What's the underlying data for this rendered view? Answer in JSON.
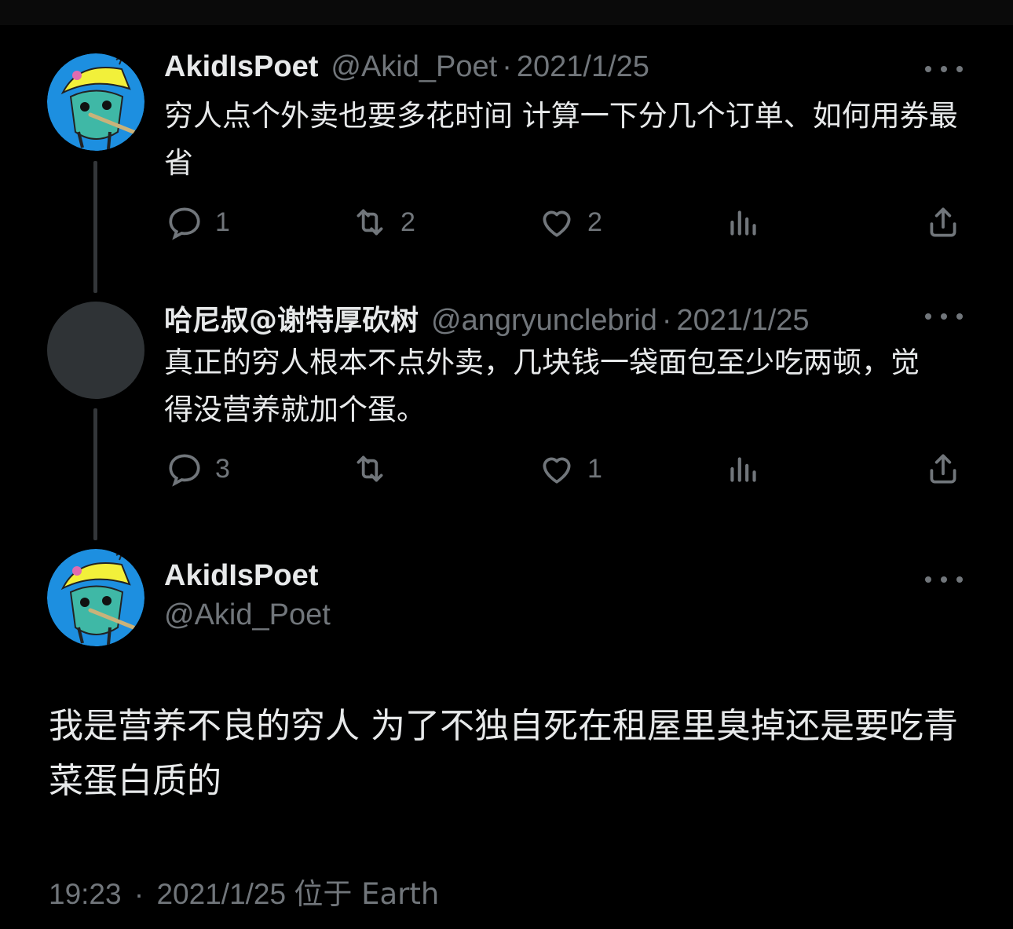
{
  "colors": {
    "background": "#000000",
    "text": "#e7e9ea",
    "muted": "#71767b",
    "thread_line": "#333639"
  },
  "tweets": [
    {
      "name": "AkidIsPoet",
      "handle": "@Akid_Poet",
      "date": "2021/1/25",
      "text": "穷人点个外卖也要多花时间 计算一下分几个订单、如何用券最省",
      "replies": "1",
      "retweets": "2",
      "likes": "2",
      "avatar": "cartoon-avatar"
    },
    {
      "name": "哈尼叔@谢特厚砍树",
      "handle": "@angryunclebrid",
      "date": "2021/1/25",
      "text": "真正的穷人根本不点外卖，几块钱一袋面包至少吃两顿，觉得没营养就加个蛋。",
      "replies": "3",
      "retweets": "",
      "likes": "1",
      "avatar": "blank-avatar"
    }
  ],
  "main": {
    "name": "AkidIsPoet",
    "handle": "@Akid_Poet",
    "text": "我是营养不良的穷人 为了不独自死在租屋里臭掉还是要吃青菜蛋白质的",
    "time": "19:23",
    "date": "2021/1/25",
    "location": "位于 Earth"
  },
  "separator": "·",
  "icons": [
    "reply-icon",
    "retweet-icon",
    "like-icon",
    "views-icon",
    "share-icon",
    "more-icon"
  ]
}
